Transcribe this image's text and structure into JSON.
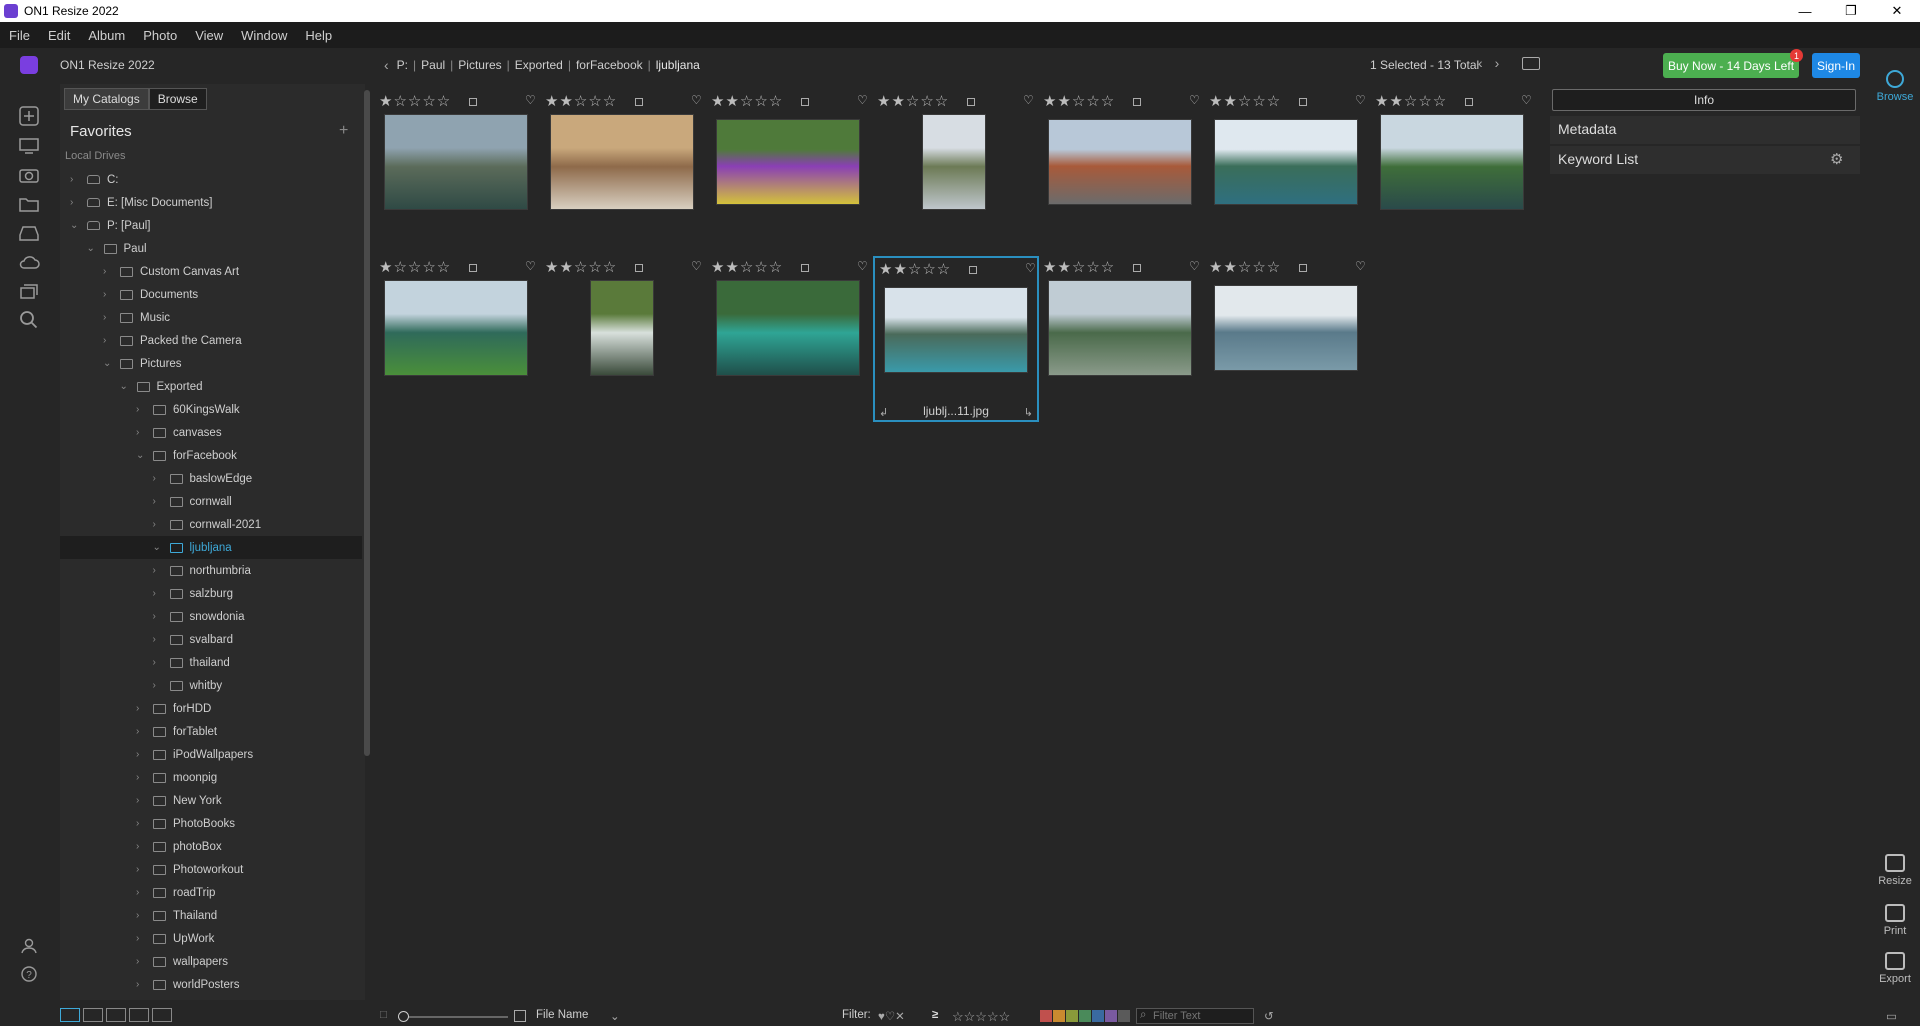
{
  "window": {
    "title": "ON1 Resize 2022",
    "controls": [
      "—",
      "❐",
      "✕"
    ]
  },
  "menu": [
    "File",
    "Edit",
    "Album",
    "Photo",
    "View",
    "Window",
    "Help"
  ],
  "header": {
    "app_name": "ON1 Resize 2022",
    "breadcrumb": [
      "P:",
      "Paul",
      "Pictures",
      "Exported",
      "forFacebook",
      "ljubljana"
    ],
    "selection_info": "1 Selected - 13 Total",
    "buy_label": "Buy Now - 14 Days Left",
    "buy_badge": "1",
    "signin_label": "Sign-In"
  },
  "left_panel": {
    "tabs": [
      {
        "label": "My Catalogs",
        "active": false
      },
      {
        "label": "Browse",
        "active": true
      }
    ],
    "favorites_title": "Favorites",
    "add_symbol": "+",
    "local_drives_label": "Local Drives",
    "tree": [
      {
        "label": "C:",
        "depth": 0,
        "drive": true,
        "expanded": false
      },
      {
        "label": "E: [Misc Documents]",
        "depth": 0,
        "drive": true,
        "expanded": false
      },
      {
        "label": "P: [Paul]",
        "depth": 0,
        "drive": true,
        "expanded": true
      },
      {
        "label": "Paul",
        "depth": 1,
        "expanded": true
      },
      {
        "label": "Custom Canvas Art",
        "depth": 2,
        "expanded": false
      },
      {
        "label": "Documents",
        "depth": 2,
        "expanded": false
      },
      {
        "label": "Music",
        "depth": 2,
        "expanded": false
      },
      {
        "label": "Packed the Camera",
        "depth": 2,
        "expanded": false
      },
      {
        "label": "Pictures",
        "depth": 2,
        "expanded": true
      },
      {
        "label": "Exported",
        "depth": 3,
        "expanded": true
      },
      {
        "label": "60KingsWalk",
        "depth": 4,
        "expanded": false
      },
      {
        "label": "canvases",
        "depth": 4,
        "expanded": false
      },
      {
        "label": "forFacebook",
        "depth": 4,
        "expanded": true
      },
      {
        "label": "baslowEdge",
        "depth": 5,
        "expanded": false
      },
      {
        "label": "cornwall",
        "depth": 5,
        "expanded": false
      },
      {
        "label": "cornwall-2021",
        "depth": 5,
        "expanded": false
      },
      {
        "label": "ljubljana",
        "depth": 5,
        "expanded": true,
        "selected": true
      },
      {
        "label": "northumbria",
        "depth": 5,
        "expanded": false
      },
      {
        "label": "salzburg",
        "depth": 5,
        "expanded": false
      },
      {
        "label": "snowdonia",
        "depth": 5,
        "expanded": false
      },
      {
        "label": "svalbard",
        "depth": 5,
        "expanded": false
      },
      {
        "label": "thailand",
        "depth": 5,
        "expanded": false
      },
      {
        "label": "whitby",
        "depth": 5,
        "expanded": false
      },
      {
        "label": "forHDD",
        "depth": 4,
        "expanded": false
      },
      {
        "label": "forTablet",
        "depth": 4,
        "expanded": false
      },
      {
        "label": "iPodWallpapers",
        "depth": 4,
        "expanded": false
      },
      {
        "label": "moonpig",
        "depth": 4,
        "expanded": false
      },
      {
        "label": "New York",
        "depth": 4,
        "expanded": false
      },
      {
        "label": "PhotoBooks",
        "depth": 4,
        "expanded": false
      },
      {
        "label": "photoBox",
        "depth": 4,
        "expanded": false
      },
      {
        "label": "Photoworkout",
        "depth": 4,
        "expanded": false
      },
      {
        "label": "roadTrip",
        "depth": 4,
        "expanded": false
      },
      {
        "label": "Thailand",
        "depth": 4,
        "expanded": false
      },
      {
        "label": "UpWork",
        "depth": 4,
        "expanded": false
      },
      {
        "label": "wallpapers",
        "depth": 4,
        "expanded": false
      },
      {
        "label": "worldPosters",
        "depth": 4,
        "expanded": false
      }
    ]
  },
  "grid": {
    "thumbnails": [
      {
        "rating": 1,
        "orientation": "landscape",
        "colors": [
          "#8fa3b0",
          "#5b6b5a",
          "#2f4a45"
        ]
      },
      {
        "rating": 2,
        "orientation": "landscape",
        "colors": [
          "#c9a87c",
          "#8e6a4a",
          "#d8cfc0"
        ]
      },
      {
        "rating": 2,
        "orientation": "landscape",
        "colors": [
          "#4f7a3a",
          "#8a3fb5",
          "#d4c23a"
        ]
      },
      {
        "rating": 2,
        "orientation": "portrait",
        "colors": [
          "#d7dde3",
          "#6c7a55",
          "#bfc6cc"
        ]
      },
      {
        "rating": 2,
        "orientation": "landscape",
        "colors": [
          "#b8c8d8",
          "#a85a3a",
          "#6b6b6b"
        ]
      },
      {
        "rating": 2,
        "orientation": "landscape",
        "colors": [
          "#dfe8ef",
          "#3a6e5a",
          "#2f6f7f"
        ]
      },
      {
        "rating": 2,
        "orientation": "landscape",
        "colors": [
          "#c9d7e0",
          "#3f6e3a",
          "#2a4a4a"
        ]
      },
      {
        "rating": 1,
        "orientation": "landscape",
        "colors": [
          "#c3d3dd",
          "#2f6a5a",
          "#4a8f3a"
        ]
      },
      {
        "rating": 2,
        "orientation": "portrait",
        "colors": [
          "#5a7a3a",
          "#d8e0dc",
          "#3a4a3a"
        ]
      },
      {
        "rating": 2,
        "orientation": "landscape",
        "colors": [
          "#3a6a3a",
          "#2fa595",
          "#1f4f4a"
        ]
      },
      {
        "rating": 2,
        "orientation": "landscape",
        "selected": true,
        "filename": "ljublj...11.jpg",
        "colors": [
          "#d8e2ea",
          "#4a6a5a",
          "#3a9aaa"
        ]
      },
      {
        "rating": 2,
        "orientation": "landscape",
        "colors": [
          "#c0ccd4",
          "#4a6a4a",
          "#8a9a8a"
        ]
      },
      {
        "rating": 2,
        "orientation": "landscape",
        "colors": [
          "#e2e8ec",
          "#5a7a8a",
          "#7a9aa8"
        ]
      }
    ]
  },
  "right_panel": {
    "info_label": "Info",
    "sections": [
      "Metadata",
      "Keyword List"
    ],
    "gear_icon": "gear-icon"
  },
  "right_strip": [
    {
      "label": "Browse",
      "active": true
    },
    {
      "label": "Resize",
      "active": false
    },
    {
      "label": "Print",
      "active": false
    },
    {
      "label": "Export",
      "active": false
    }
  ],
  "bottom": {
    "sort_label": "File Name",
    "filter_label": "Filter:",
    "filter_placeholder": "Filter Text",
    "swatches": [
      "#c0504d",
      "#c98a2f",
      "#8a9a3a",
      "#4a8a5a",
      "#3a6aa0",
      "#7a5aa0",
      "#5a5a5a"
    ]
  }
}
